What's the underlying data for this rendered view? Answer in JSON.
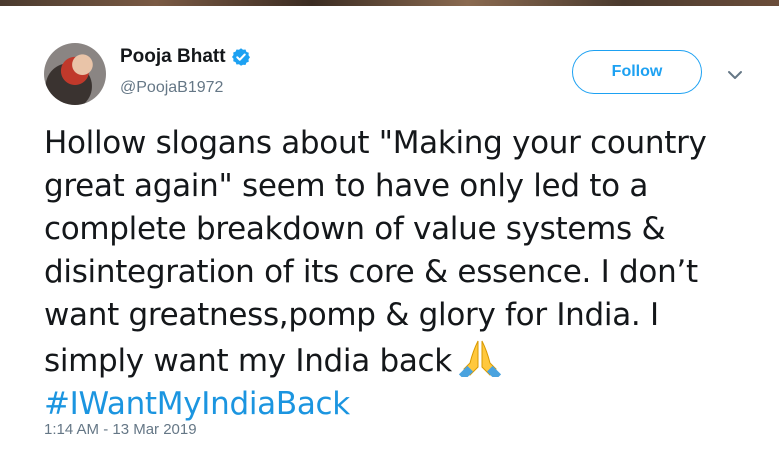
{
  "author": {
    "display_name": "Pooja Bhatt",
    "handle": "@PoojaB1972",
    "verified": true
  },
  "follow_button": {
    "label": "Follow"
  },
  "tweet": {
    "text_lines": [
      "Hollow slogans about \"Making your country",
      "great again\" seem to have only led to a",
      "complete breakdown of value systems &",
      "disintegration of its core & essence. I don’t",
      "want greatness,pomp & glory for India. I",
      "simply want my India back"
    ],
    "emoji": "folded-hands",
    "hashtag": "#IWantMyIndiaBack"
  },
  "timestamp": "1:14 AM - 13 Mar 2019",
  "colors": {
    "accent": "#1da1f2",
    "hashtag": "#1b95e0",
    "text": "#14171a",
    "muted": "#657786"
  },
  "icons": [
    "verified-badge-icon",
    "chevron-down-icon",
    "folded-hands-icon"
  ]
}
